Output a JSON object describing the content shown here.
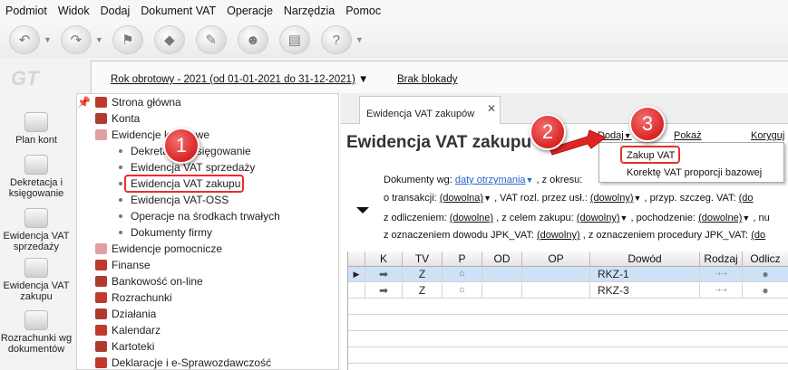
{
  "menu": [
    "Podmiot",
    "Widok",
    "Dodaj",
    "Dokument VAT",
    "Operacje",
    "Narzędzia",
    "Pomoc"
  ],
  "logo": "GT",
  "left_nav": [
    "Plan kont",
    "Dekretacja i księgowanie",
    "Ewidencja VAT sprzedaży",
    "Ewidencja VAT zakupu",
    "Rozrachunki wg dokumentów"
  ],
  "year_bar": {
    "label": "Rok obrotowy - 2021  (od 01-01-2021 do 31-12-2021)",
    "arrow": "▼",
    "lock": "Brak blokady"
  },
  "tree": {
    "strona": "Strona główna",
    "konta": "Konta",
    "ewidencje_ksiegowe": "Ewidencje księgowe",
    "dekretacja": "Dekretacja i księgowanie",
    "vat_sprzedazy": "Ewidencja VAT sprzedaży",
    "vat_zakupu": "Ewidencja VAT zakupu",
    "vat_oss": "Ewidencja VAT-OSS",
    "srodki_trwale": "Operacje na środkach trwałych",
    "dokumenty_firmy": "Dokumenty firmy",
    "pomocnicze": "Ewidencje pomocnicze",
    "finanse": "Finanse",
    "bankowosc": "Bankowość on-line",
    "rozrachunki": "Rozrachunki",
    "dzialania": "Działania",
    "kalendarz": "Kalendarz",
    "kartoteki": "Kartoteki",
    "deklaracje": "Deklaracje i e-Sprawozdawczość"
  },
  "tab": {
    "label": "Ewidencja VAT zakupów",
    "close": "✕"
  },
  "page_title": "Ewidencja VAT zakupu",
  "actions": {
    "dodaj": "Dodaj",
    "dodaj_arrow": "▼",
    "pokaz": "Pokaż",
    "koryguj": "Koryguj"
  },
  "dropdown": [
    "Zakup VAT",
    "Korektę VAT proporcji bazowej"
  ],
  "filters": {
    "dok_label": "Dokumenty wg:",
    "dok_value": "daty otrzymania",
    "okres_label": ", z okresu:",
    "trans_label": "o transakcji:",
    "trans_value": "(dowolna)",
    "rozl_label": ", VAT rozl. przez usł.:",
    "rozl_value": "(dowolny)",
    "przyp_label": ", przyp. szczeg. VAT:",
    "przyp_value": "(do",
    "odl_label": "z odliczeniem:",
    "odl_value": "(dowolne)",
    "cel_label": ", z celem zakupu:",
    "cel_value": "(dowolny)",
    "poch_label": ", pochodzenie:",
    "poch_value": "(dowolne)",
    "nu_label": ", nu",
    "jpk_label": "z oznaczeniem dowodu JPK_VAT:",
    "jpk_value": "(dowolny)",
    "jpkproc_label": ", z oznaczeniem procedury JPK_VAT:",
    "jpkproc_value": "(do",
    "arrow": "▼"
  },
  "grid": {
    "headers": [
      "K",
      "TV",
      "P",
      "OD",
      "OP",
      "Dowód",
      "Rodzaj",
      "Odlicz"
    ],
    "rows": [
      {
        "marker": "▶",
        "tv": "Z",
        "dowod": "RKZ-1"
      },
      {
        "marker": "",
        "tv": "Z",
        "dowod": "RKZ-3"
      }
    ]
  },
  "badges": [
    "1",
    "2",
    "3"
  ],
  "colors": {
    "highlight": "#e53030",
    "selected_row": "#cfe1f7",
    "link_blue": "#2a64c8"
  }
}
